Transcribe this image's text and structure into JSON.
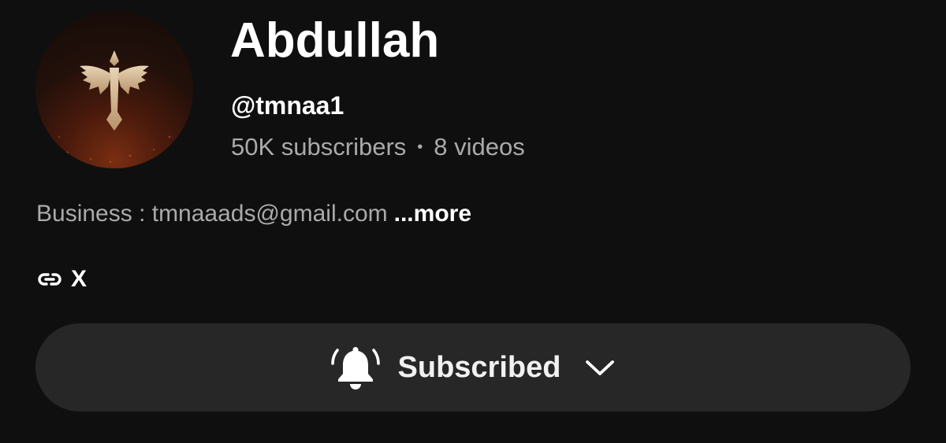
{
  "channel": {
    "name": "Abdullah",
    "handle": "@tmnaa1",
    "subscribers": "50K subscribers",
    "separator": "•",
    "videos": "8 videos",
    "avatar_icon": "winged-sword-emblem"
  },
  "description": {
    "text": "Business : tmnaaads@gmail.com",
    "more_label": "...more"
  },
  "links": {
    "icon": "link-icon",
    "label": "X"
  },
  "subscribe_button": {
    "label": "Subscribed",
    "bell_icon": "bell-ringing-icon",
    "chevron_icon": "chevron-down-icon"
  },
  "colors": {
    "background": "#0f0f0f",
    "button_background": "#272727",
    "primary_text": "#ffffff",
    "secondary_text": "#aaaaaa"
  }
}
